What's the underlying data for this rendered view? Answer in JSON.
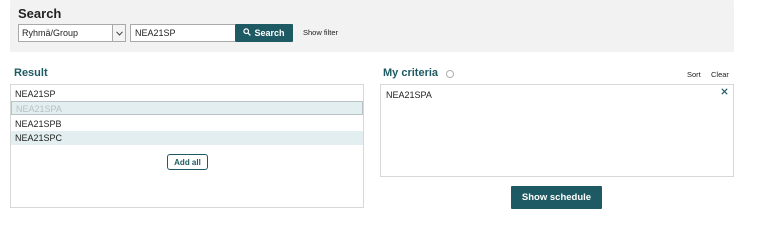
{
  "search": {
    "title": "Search",
    "group_select": "Ryhmä/Group",
    "query_value": "NEA21SP",
    "search_button": "Search",
    "show_filter": "Show filter"
  },
  "result": {
    "title": "Result",
    "items": [
      "NEA21SP",
      "NEA21SPA",
      "NEA21SPB",
      "NEA21SPC"
    ],
    "add_all": "Add all"
  },
  "criteria": {
    "title": "My criteria",
    "sort": "Sort",
    "clear": "Clear",
    "items": [
      "NEA21SPA"
    ]
  },
  "show_schedule": "Show schedule",
  "colors": {
    "accent": "#1e5a63",
    "panel_bg": "#f2f2f2",
    "row_highlight": "#e2eeef"
  }
}
